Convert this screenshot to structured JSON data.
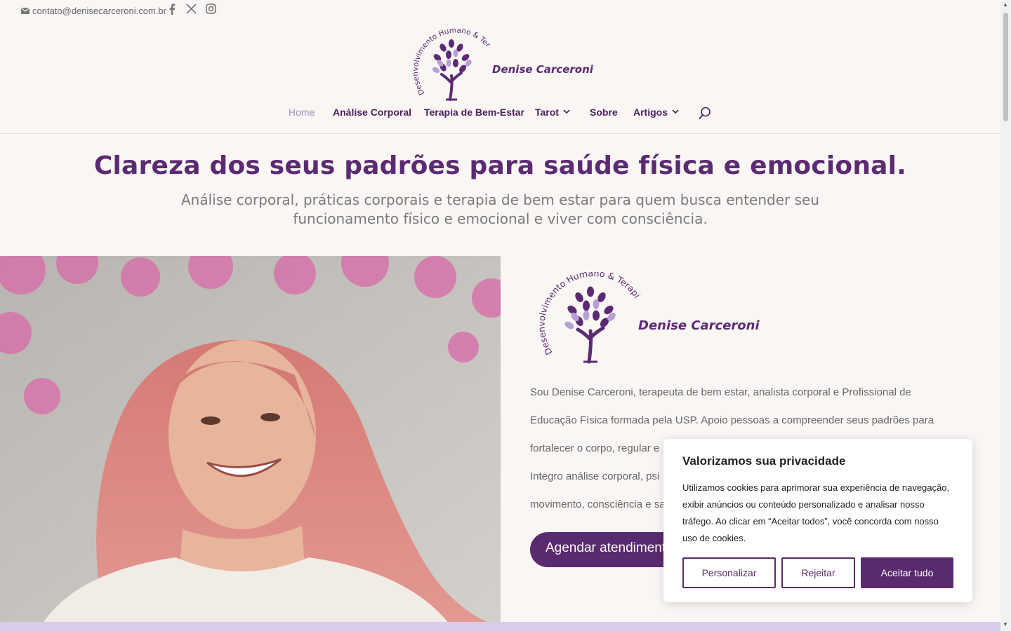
{
  "topbar": {
    "email": "contato@denisecarceroni.com.br",
    "social": [
      "facebook-icon",
      "x-twitter-icon",
      "instagram-icon"
    ]
  },
  "brand": {
    "name": "Denise Carceroni",
    "tagline": "Desenvolvimento Humano & Terapia"
  },
  "nav": {
    "items": [
      {
        "label": "Home"
      },
      {
        "label": "Análise Corporal"
      },
      {
        "label": "Terapia de Bem-Estar"
      },
      {
        "label": "Tarot"
      },
      {
        "label": "Sobre"
      },
      {
        "label": "Artigos"
      }
    ]
  },
  "hero": {
    "headline": "Clareza dos seus padrões para saúde física e emocional.",
    "subline": "Análise corporal, práticas corporais e terapia de bem estar para quem busca entender seu funcionamento físico e emocional e viver com consciência."
  },
  "about": {
    "line1": "Sou Denise Carceroni, terapeuta de bem estar, analista corporal e Profissional de",
    "line2": "Educação Física formada pela USP. Apoio pessoas a compreender seus padrões para",
    "line3": "fortalecer o corpo, regular e",
    "line4": "Integro análise corporal, psi",
    "line5": "movimento, consciência e sa",
    "cta": "Agendar atendimento"
  },
  "cookie": {
    "title": "Valorizamos sua privacidade",
    "body": "Utilizamos cookies para aprimorar sua experiência de navegação, exibir anúncios ou conteúdo personalizado e analisar nosso tráfego. Ao clicar em “Aceitar todos”, você concorda com nosso uso de cookies.",
    "customize": "Personalizar",
    "reject": "Rejeitar",
    "accept": "Aceitar tudo"
  },
  "colors": {
    "brand_purple": "#5a2a6f",
    "nav_purple": "#4b1f5d",
    "active_nav": "#a58bc2",
    "background": "#f9f6f4"
  }
}
